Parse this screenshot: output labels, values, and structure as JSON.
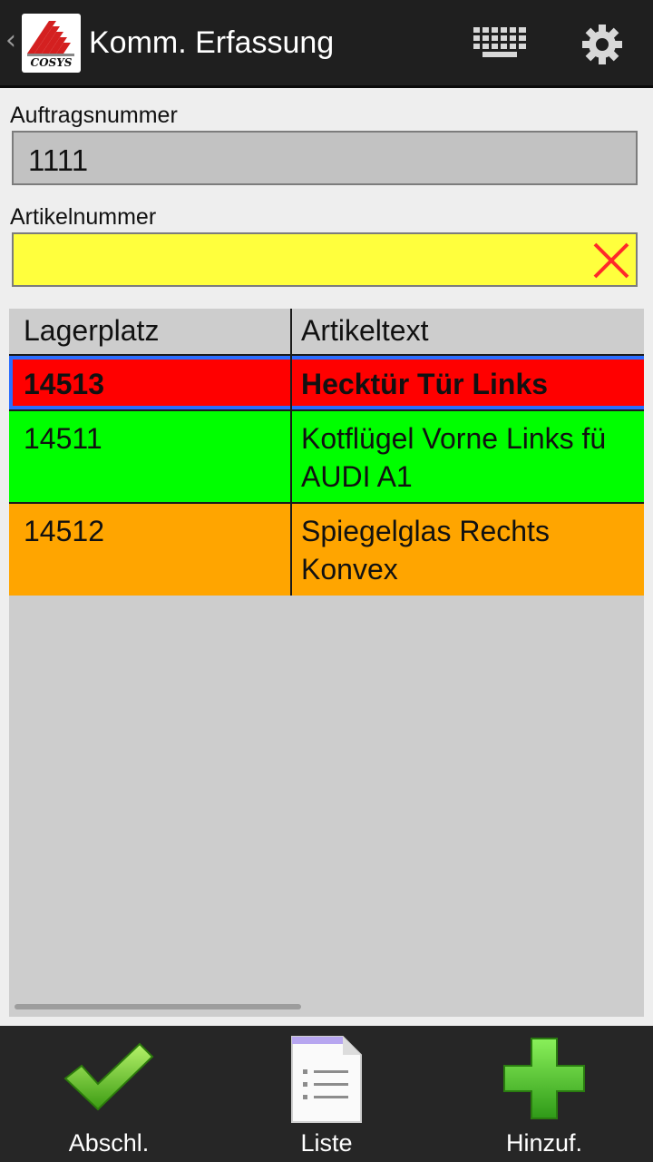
{
  "actionbar": {
    "title": "Komm. Erfassung",
    "back_icon": "chevron-left-icon",
    "logo_text": "COSYS",
    "icons": [
      "keyboard-icon",
      "gear-icon"
    ]
  },
  "order_field": {
    "label": "Auftragsnummer",
    "value": "1111"
  },
  "article_field": {
    "label": "Artikelnummer",
    "value": "",
    "clear_icon": "clear-x-icon"
  },
  "table": {
    "headers": [
      "Lagerplatz",
      "Artikeltext"
    ],
    "rows": [
      {
        "place": "14513",
        "text_lines": [
          "Hecktür Tür Links"
        ],
        "color": "#ff0000",
        "selected": true
      },
      {
        "place": "14511",
        "text_lines": [
          "Kotflügel Vorne Links fü",
          "AUDI A1"
        ],
        "color": "#00ff00",
        "selected": false
      },
      {
        "place": "14512",
        "text_lines": [
          "Spiegelglas Rechts",
          "Konvex"
        ],
        "color": "#ffa500",
        "selected": false
      }
    ]
  },
  "bottombar": {
    "buttons": [
      {
        "label": "Abschl.",
        "icon": "checkmark-icon"
      },
      {
        "label": "Liste",
        "icon": "document-list-icon"
      },
      {
        "label": "Hinzuf.",
        "icon": "plus-icon"
      }
    ]
  },
  "colors": {
    "actionbar": "#1f1f1f",
    "order_field_bg": "#c2c2c2",
    "article_field_bg": "#ffff3d",
    "selection_border": "#2a6dff",
    "table_bg": "#cdcdcd"
  }
}
